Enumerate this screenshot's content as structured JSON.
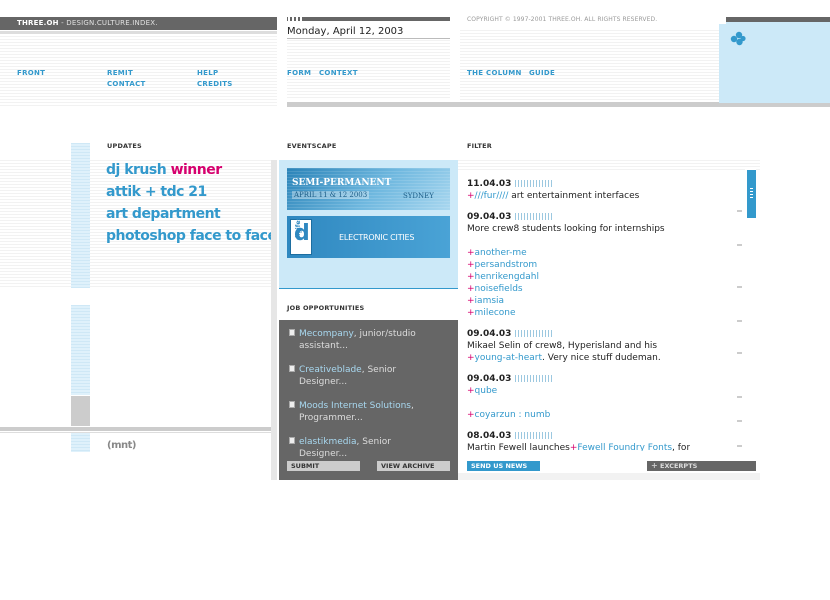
{
  "header": {
    "brand": "THREE.OH",
    "tagline": " - DESIGN.CULTURE.INDEX.",
    "date": "Monday, April 12, 2003",
    "copyright": "COPYRIGHT © 1997-2001 THREE.OH. ALL RIGHTS RESERVED."
  },
  "nav": {
    "front": "FRONT",
    "remit": "REMIT",
    "contact": "CONTACT",
    "help": "HELP",
    "credits": "CREDITS",
    "form": "FORM",
    "context": "CONTEXT",
    "the_column": "THE COLUMN",
    "guide": "GUIDE"
  },
  "sections": {
    "updates": "UPDATES",
    "eventscape": "EVENTSCAPE",
    "filter": "FILTER",
    "job_opportunities": "JOB OPPORTUNITIES"
  },
  "updates": [
    {
      "text": "dj krush ",
      "highlight": "winner"
    },
    {
      "text": "attik + tdc 21"
    },
    {
      "text": "art department"
    },
    {
      "text": "photoshop face to face"
    }
  ],
  "banners": {
    "semi": {
      "title": "SEMI-PERMANENT",
      "dates": "APRIL 11 & 12 2003",
      "city": "SYDNEY"
    },
    "digifest": {
      "logo_letter": "d",
      "logo_word": "digifest",
      "title": "ELECTRONIC CITIES"
    }
  },
  "jobs": [
    {
      "company": "Mecompany",
      "role": ", junior/studio assistant..."
    },
    {
      "company": "Creativeblade",
      "role": ", Senior Designer..."
    },
    {
      "company": "Moods Internet Solutions",
      "role": ", Programmer..."
    },
    {
      "company": "elastikmedia",
      "role": ", Senior Designer..."
    }
  ],
  "job_buttons": {
    "submit": "SUBMIT",
    "view_archive": "VIEW ARCHIVE"
  },
  "filter": {
    "e1_date": "11.04.03",
    "e1_plus": "+",
    "e1_link": "///fur////",
    "e1_text": " art entertainment interfaces",
    "e2_date": "09.04.03",
    "e2_text": "More crew8 students looking for internships",
    "links": [
      "another-me",
      "persandstrom",
      "henrikengdahl",
      "noisefields",
      "iamsia",
      "milecone"
    ],
    "e3_date": "09.04.03",
    "e3_line1": "Mikael Selin of crew8, Hyperisland and his",
    "e3_link": "young-at-heart",
    "e3_line2": ". Very nice stuff dudeman.",
    "e4_date": "09.04.03",
    "e4_link": "qube",
    "e5_link": "coyarzun : numb",
    "e6_date": "08.04.03",
    "e6_text": "Martin Fewell launches",
    "e6_link": "Fewell Foundry Fonts",
    "e6_tail": ", for",
    "plus": "+"
  },
  "filter_buttons": {
    "send_news": "SEND US NEWS",
    "excerpts": "EXCERPTS"
  },
  "footer_logo": "(mnt)",
  "colors": {
    "accent": "#3399cc",
    "highlight": "#d6006e",
    "dark": "#666666",
    "light_blue": "#cce9f8"
  }
}
